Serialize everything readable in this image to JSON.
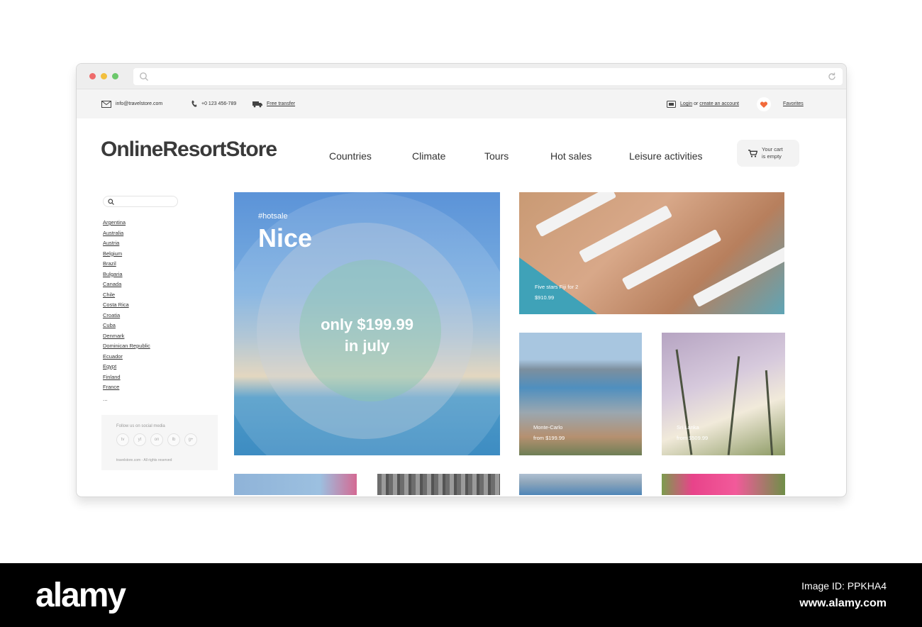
{
  "topbar": {
    "email": "info@travelstore.com",
    "phone": "+0 123 456-789",
    "transfer": "Free transfer",
    "login": "Login",
    "login_or": "or",
    "create_account": "create an account",
    "favorites": "Favorites"
  },
  "header": {
    "logo": "OnlineResortStore",
    "nav": [
      "Countries",
      "Climate",
      "Tours",
      "Hot sales",
      "Leisure activities"
    ],
    "cart_line1": "Your cart",
    "cart_line2": "is empty"
  },
  "sidebar": {
    "search_placeholder": "",
    "countries": [
      "Argentina",
      "Australia",
      "Austria",
      "Belgium",
      "Brazil",
      "Bulgaria",
      "Canada",
      "Chile",
      "Costa Rica",
      "Croatia",
      "Cuba",
      "Denmark",
      "Dominican Republic",
      "Ecuador",
      "Egypt",
      "Finland",
      "France"
    ],
    "more": "...",
    "social_title": "Follow us on social media",
    "social": [
      "tv",
      "yt",
      "on",
      "lb",
      "g+"
    ],
    "copyright": "travelstore.com - All rights reserved"
  },
  "hero": {
    "tag": "#hotsale",
    "title": "Nice",
    "price_line1": "only $199.99",
    "price_line2": "in july"
  },
  "tiles": [
    {
      "title": "Five stars Fiji for 2",
      "price": "$910.99"
    },
    {
      "title": "Monte-Carlo",
      "price": "from $199.99"
    },
    {
      "title": "Sri Lanka",
      "price": "from $509.99"
    }
  ],
  "watermark": {
    "brand": "alamy",
    "image_id": "Image ID: PPKHA4",
    "site": "www.alamy.com"
  },
  "colors": {
    "favorite": "#f26a3b",
    "hero_sky": "#5b93d8",
    "footer_bg": "#000000"
  }
}
